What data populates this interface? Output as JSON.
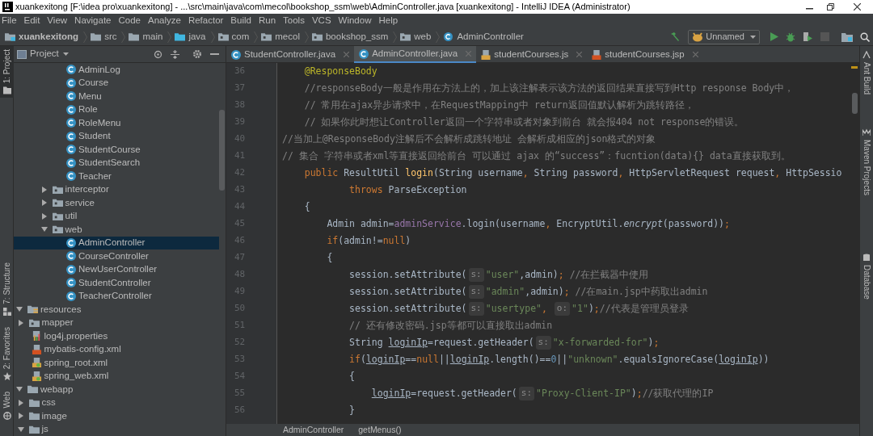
{
  "window": {
    "title": "xuankexitong [F:\\idea pro\\xuankexitong] - ...\\src\\main\\java\\com\\mecol\\bookshop_ssm\\web\\AdminController.java [xuankexitong] - IntelliJ IDEA (Administrator)"
  },
  "menu": [
    "File",
    "Edit",
    "View",
    "Navigate",
    "Code",
    "Analyze",
    "Refactor",
    "Build",
    "Run",
    "Tools",
    "VCS",
    "Window",
    "Help"
  ],
  "breadcrumb": [
    {
      "label": "xuankexitong",
      "kind": "project"
    },
    {
      "label": "src",
      "kind": "folder"
    },
    {
      "label": "main",
      "kind": "folder"
    },
    {
      "label": "java",
      "kind": "source"
    },
    {
      "label": "com",
      "kind": "package"
    },
    {
      "label": "mecol",
      "kind": "package"
    },
    {
      "label": "bookshop_ssm",
      "kind": "package"
    },
    {
      "label": "web",
      "kind": "package"
    },
    {
      "label": "AdminController",
      "kind": "class"
    }
  ],
  "run_config": {
    "label": "Unnamed"
  },
  "left_strip": [
    {
      "label": "1: Project",
      "selected": true
    },
    {
      "label": "7: Structure",
      "selected": false
    },
    {
      "label": "2: Favorites",
      "selected": false
    },
    {
      "label": "Web",
      "selected": false
    }
  ],
  "right_strip": [
    "Ant Build",
    "Maven Projects",
    "Database"
  ],
  "project_panel": {
    "title": "Project",
    "tree": [
      {
        "children": [
          {
            "children": [
              {
                "children": [
                  {
                    "children": [
                      {
                        "label": "AdminLog",
                        "kind": "class",
                        "selected": false
                      },
                      {
                        "label": "Course",
                        "kind": "class",
                        "selected": false
                      },
                      {
                        "label": "Menu",
                        "kind": "class",
                        "selected": false
                      },
                      {
                        "label": "Role",
                        "kind": "class",
                        "selected": false
                      },
                      {
                        "label": "RoleMenu",
                        "kind": "class",
                        "selected": false
                      },
                      {
                        "label": "Student",
                        "kind": "class",
                        "selected": false
                      },
                      {
                        "label": "StudentCourse",
                        "kind": "class",
                        "selected": false
                      },
                      {
                        "label": "StudentSearch",
                        "kind": "class",
                        "selected": false
                      },
                      {
                        "label": "Teacher",
                        "kind": "class",
                        "selected": false
                      }
                    ]
                  },
                  {
                    "label": "interceptor",
                    "kind": "package",
                    "expanded": false,
                    "selected": false
                  },
                  {
                    "label": "service",
                    "kind": "package",
                    "expanded": false,
                    "selected": false
                  },
                  {
                    "label": "util",
                    "kind": "package",
                    "expanded": false,
                    "selected": false
                  },
                  {
                    "label": "web",
                    "kind": "package",
                    "expanded": true,
                    "selected": false,
                    "children": [
                      {
                        "label": "AdminController",
                        "kind": "class",
                        "selected": true
                      },
                      {
                        "label": "CourseController",
                        "kind": "class",
                        "selected": false
                      },
                      {
                        "label": "NewUserController",
                        "kind": "class",
                        "selected": false
                      },
                      {
                        "label": "StudentController",
                        "kind": "class",
                        "selected": false
                      },
                      {
                        "label": "TeacherController",
                        "kind": "class",
                        "selected": false
                      }
                    ]
                  }
                ]
              }
            ]
          }
        ]
      },
      {
        "label": "resources",
        "kind": "resources",
        "expanded": true,
        "selected": false,
        "children": [
          {
            "label": "mapper",
            "kind": "package",
            "expanded": false,
            "selected": false
          },
          {
            "label": "log4j.properties",
            "kind": "properties",
            "selected": false
          },
          {
            "label": "mybatis-config.xml",
            "kind": "xml",
            "selected": false
          },
          {
            "label": "spring_root.xml",
            "kind": "spring",
            "selected": false
          },
          {
            "label": "spring_web.xml",
            "kind": "spring",
            "selected": false
          }
        ]
      },
      {
        "label": "webapp",
        "kind": "folder",
        "expanded": true,
        "selected": false,
        "children": [
          {
            "label": "css",
            "kind": "folder",
            "expanded": false,
            "selected": false
          },
          {
            "label": "image",
            "kind": "folder",
            "expanded": false,
            "selected": false
          },
          {
            "label": "js",
            "kind": "folder",
            "expanded": true,
            "selected": false
          }
        ]
      }
    ]
  },
  "editor_tabs": [
    {
      "label": "StudentController.java",
      "kind": "class",
      "selected": false
    },
    {
      "label": "AdminController.java",
      "kind": "class",
      "selected": true
    },
    {
      "label": "studentCourses.js",
      "kind": "js",
      "selected": false
    },
    {
      "label": "studentCourses.jsp",
      "kind": "jsp",
      "selected": false
    }
  ],
  "code": [
    {
      "number": "36",
      "tokens": [
        {
          "t": "    @ResponseBody",
          "kind": "annotation"
        }
      ]
    },
    {
      "number": "37",
      "tokens": [
        {
          "t": "    //responseBody一般是作用在方法上的，加上该注解表示该方法的返回结果直接写到Http response Body中，",
          "kind": "comment"
        }
      ]
    },
    {
      "number": "38",
      "tokens": [
        {
          "t": "    // 常用在ajax异步请求中，在RequestMapping中 return返回值默认解析为跳转路径，",
          "kind": "comment"
        }
      ]
    },
    {
      "number": "39",
      "tokens": [
        {
          "t": "    // 如果你此时想让Controller返回一个字符串或者对象到前台 就会报404 not response的错误。",
          "kind": "comment"
        }
      ]
    },
    {
      "number": "40",
      "tokens": [
        {
          "t": "//当加上@ResponseBody注解后不会解析成跳转地址 会解析成相应的json格式的对象",
          "kind": "comment"
        }
      ]
    },
    {
      "number": "41",
      "tokens": [
        {
          "t": "// 集合 字符串或者xml等直接返回给前台 可以通过 ajax 的“success”：fucntion(data){} data直接获取到。",
          "kind": "comment"
        }
      ]
    },
    {
      "number": "42",
      "tokens": [
        {
          "t": "    public ",
          "kind": "keyword"
        },
        {
          "t": "ResultUtil ",
          "kind": "plain"
        },
        {
          "t": "login",
          "kind": "method"
        },
        {
          "t": "(String username",
          "kind": "plain"
        },
        {
          "t": ", ",
          "kind": "keyword"
        },
        {
          "t": "String password",
          "kind": "plain"
        },
        {
          "t": ", ",
          "kind": "keyword"
        },
        {
          "t": "HttpServletRequest request",
          "kind": "plain"
        },
        {
          "t": ", ",
          "kind": "keyword"
        },
        {
          "t": "HttpSessio",
          "kind": "plain"
        }
      ]
    },
    {
      "number": "43",
      "tokens": [
        {
          "t": "            throws ",
          "kind": "keyword"
        },
        {
          "t": "ParseException",
          "kind": "plain"
        }
      ]
    },
    {
      "number": "44",
      "tokens": [
        {
          "t": "    {",
          "kind": "plain"
        }
      ]
    },
    {
      "number": "45",
      "tokens": [
        {
          "t": "        Admin admin=",
          "kind": "plain"
        },
        {
          "t": "adminService",
          "kind": "field"
        },
        {
          "t": ".login(username",
          "kind": "plain"
        },
        {
          "t": ", ",
          "kind": "keyword"
        },
        {
          "t": "EncryptUtil.",
          "kind": "plain"
        },
        {
          "t": "encrypt",
          "kind": "italic"
        },
        {
          "t": "(password))",
          "kind": "plain"
        },
        {
          "t": ";",
          "kind": "keyword"
        }
      ]
    },
    {
      "number": "46",
      "tokens": [
        {
          "t": "        if",
          "kind": "keyword"
        },
        {
          "t": "(admin!=",
          "kind": "plain"
        },
        {
          "t": "null",
          "kind": "keyword"
        },
        {
          "t": ")",
          "kind": "plain"
        }
      ]
    },
    {
      "number": "47",
      "tokens": [
        {
          "t": "        {",
          "kind": "plain"
        }
      ]
    },
    {
      "number": "48",
      "tokens": [
        {
          "t": "            session.setAttribute(",
          "kind": "plain"
        },
        {
          "t": "s:",
          "kind": "hint"
        },
        {
          "t": "\"user\"",
          "kind": "string"
        },
        {
          "t": ",admin)",
          "kind": "plain"
        },
        {
          "t": ";",
          "kind": "keyword"
        },
        {
          "t": " //在拦截器中使用",
          "kind": "comment"
        }
      ]
    },
    {
      "number": "49",
      "tokens": [
        {
          "t": "            session.setAttribute(",
          "kind": "plain"
        },
        {
          "t": "s:",
          "kind": "hint"
        },
        {
          "t": "\"admin\"",
          "kind": "string"
        },
        {
          "t": ",admin)",
          "kind": "plain"
        },
        {
          "t": ";",
          "kind": "keyword"
        },
        {
          "t": " //在main.jsp中药取出admin",
          "kind": "comment"
        }
      ]
    },
    {
      "number": "50",
      "tokens": [
        {
          "t": "            session.setAttribute(",
          "kind": "plain"
        },
        {
          "t": "s:",
          "kind": "hint"
        },
        {
          "t": "\"usertype\"",
          "kind": "string"
        },
        {
          "t": ", ",
          "kind": "keyword"
        },
        {
          "t": "o:",
          "kind": "hint"
        },
        {
          "t": "\"1\"",
          "kind": "string"
        },
        {
          "t": ")",
          "kind": "plain"
        },
        {
          "t": ";",
          "kind": "keyword"
        },
        {
          "t": "//代表是管理员登录",
          "kind": "comment"
        }
      ]
    },
    {
      "number": "51",
      "tokens": [
        {
          "t": "            // 还有修改密码.jsp等都可以直接取出admin",
          "kind": "comment"
        }
      ]
    },
    {
      "number": "52",
      "tokens": [
        {
          "t": "            String ",
          "kind": "plain"
        },
        {
          "t": "loginIp",
          "kind": "reassigned"
        },
        {
          "t": "=request.getHeader(",
          "kind": "plain"
        },
        {
          "t": "s:",
          "kind": "hint"
        },
        {
          "t": "\"x-forwarded-for\"",
          "kind": "string"
        },
        {
          "t": ")",
          "kind": "plain"
        },
        {
          "t": ";",
          "kind": "keyword"
        }
      ]
    },
    {
      "number": "53",
      "tokens": [
        {
          "t": "            if",
          "kind": "keyword"
        },
        {
          "t": "(",
          "kind": "plain"
        },
        {
          "t": "loginIp",
          "kind": "reassigned"
        },
        {
          "t": "==",
          "kind": "plain"
        },
        {
          "t": "null",
          "kind": "keyword"
        },
        {
          "t": "||",
          "kind": "plain"
        },
        {
          "t": "loginIp",
          "kind": "reassigned"
        },
        {
          "t": ".length()==",
          "kind": "plain"
        },
        {
          "t": "0",
          "kind": "number"
        },
        {
          "t": "||",
          "kind": "plain"
        },
        {
          "t": "\"unknown\"",
          "kind": "string"
        },
        {
          "t": ".equalsIgnoreCase(",
          "kind": "plain"
        },
        {
          "t": "loginIp",
          "kind": "reassigned"
        },
        {
          "t": "))",
          "kind": "plain"
        }
      ]
    },
    {
      "number": "54",
      "tokens": [
        {
          "t": "            {",
          "kind": "plain"
        }
      ]
    },
    {
      "number": "55",
      "tokens": [
        {
          "t": "                loginIp",
          "kind": "reassigned"
        },
        {
          "t": "=request.getHeader(",
          "kind": "plain"
        },
        {
          "t": "s:",
          "kind": "hint"
        },
        {
          "t": "\"Proxy-Client-IP\"",
          "kind": "string"
        },
        {
          "t": ")",
          "kind": "plain"
        },
        {
          "t": ";",
          "kind": "keyword"
        },
        {
          "t": "//获取代理的IP",
          "kind": "comment"
        }
      ]
    },
    {
      "number": "56",
      "tokens": [
        {
          "t": "            }",
          "kind": "plain"
        }
      ]
    }
  ],
  "status_breadcrumb": [
    "AdminController",
    "getMenus()"
  ]
}
